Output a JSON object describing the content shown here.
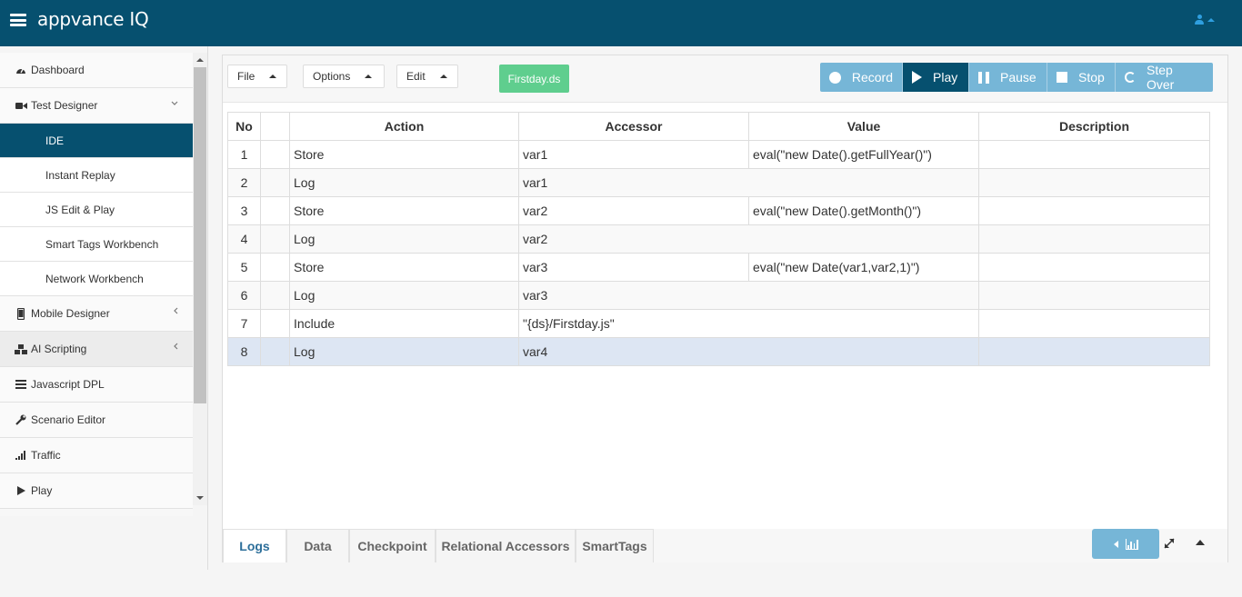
{
  "app": {
    "logo": "appvance IQ"
  },
  "sidebar": {
    "items": [
      {
        "label": "Dashboard"
      },
      {
        "label": "Test Designer"
      },
      {
        "label": "IDE"
      },
      {
        "label": "Instant Replay"
      },
      {
        "label": "JS Edit & Play"
      },
      {
        "label": "Smart Tags Workbench"
      },
      {
        "label": "Network Workbench"
      },
      {
        "label": "Mobile Designer"
      },
      {
        "label": "AI Scripting"
      },
      {
        "label": "Javascript DPL"
      },
      {
        "label": "Scenario Editor"
      },
      {
        "label": "Traffic"
      },
      {
        "label": "Play"
      }
    ]
  },
  "toolbar": {
    "file": "File",
    "options": "Options",
    "edit": "Edit",
    "file_name": "Firstday.ds",
    "record": "Record",
    "play": "Play",
    "pause": "Pause",
    "stop": "Stop",
    "step_over": "Step Over"
  },
  "table": {
    "headers": [
      "No",
      "",
      "Action",
      "Accessor",
      "Value",
      "Description"
    ],
    "rows": [
      {
        "no": "1",
        "action": "Store",
        "accessor": "var1",
        "value": "eval(\"new Date().getFullYear()\")",
        "description": ""
      },
      {
        "no": "2",
        "action": "Log",
        "accessor": "var1",
        "value": "",
        "description": ""
      },
      {
        "no": "3",
        "action": "Store",
        "accessor": "var2",
        "value": "eval(\"new Date().getMonth()\")",
        "description": ""
      },
      {
        "no": "4",
        "action": "Log",
        "accessor": "var2",
        "value": "",
        "description": ""
      },
      {
        "no": "5",
        "action": "Store",
        "accessor": "var3",
        "value": "eval(\"new Date(var1,var2,1)\")",
        "description": ""
      },
      {
        "no": "6",
        "action": "Log",
        "accessor": "var3",
        "value": "",
        "description": ""
      },
      {
        "no": "7",
        "action": "Include",
        "accessor": "\"{ds}/Firstday.js\"",
        "value": "",
        "description": ""
      },
      {
        "no": "8",
        "action": "Log",
        "accessor": "var4",
        "value": "",
        "description": ""
      }
    ]
  },
  "bottom_tabs": [
    "Logs",
    "Data",
    "Checkpoint",
    "Relational Accessors",
    "SmartTags"
  ],
  "colors": {
    "header": "#06506f",
    "control": "#76b6d7",
    "file_badge": "#5fce8e",
    "selected_row": "#dde6f3"
  }
}
